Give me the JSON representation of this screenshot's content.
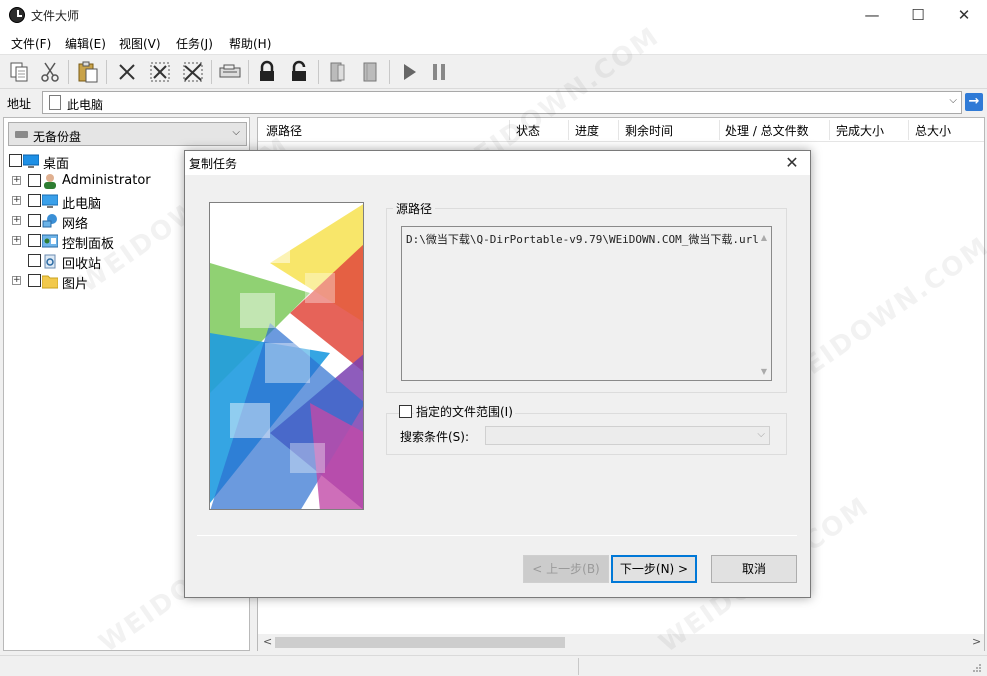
{
  "window": {
    "title": "文件大师",
    "controls": {
      "minimize": "—",
      "maximize": "☐",
      "close": "✕"
    }
  },
  "menu": [
    {
      "label": "文件(F)"
    },
    {
      "label": "编辑(E)"
    },
    {
      "label": "视图(V)"
    },
    {
      "label": "任务(J)"
    },
    {
      "label": "帮助(H)"
    }
  ],
  "toolbar": {
    "buttons": [
      "copy-icon",
      "cut-icon",
      "paste-icon",
      "delete-icon",
      "delete-selection-icon",
      "delete-all-icon",
      "device-icon",
      "lock-icon",
      "unlock-icon",
      "book-open-icon",
      "book-close-icon",
      "play-icon",
      "pause-icon"
    ]
  },
  "address": {
    "label": "地址",
    "value": "此电脑",
    "go": "→"
  },
  "left_panel": {
    "backup_combo": "无备份盘",
    "tree": [
      {
        "label": "桌面",
        "icon": "desktop-icon",
        "level": 0,
        "expandable": false
      },
      {
        "label": "Administrator",
        "icon": "user-icon",
        "level": 1,
        "expandable": true
      },
      {
        "label": "此电脑",
        "icon": "computer-icon",
        "level": 1,
        "expandable": true
      },
      {
        "label": "网络",
        "icon": "network-icon",
        "level": 1,
        "expandable": true
      },
      {
        "label": "控制面板",
        "icon": "control-panel-icon",
        "level": 1,
        "expandable": true
      },
      {
        "label": "回收站",
        "icon": "recycle-bin-icon",
        "level": 1,
        "expandable": false
      },
      {
        "label": "图片",
        "icon": "folder-icon",
        "level": 1,
        "expandable": true
      }
    ]
  },
  "task_table": {
    "columns": [
      "源路径",
      "状态",
      "进度",
      "剩余时间",
      "处理 / 总文件数",
      "完成大小",
      "总大小"
    ]
  },
  "scroll": {
    "left": "<",
    "right": ">"
  },
  "dialog": {
    "title": "复制任务",
    "close": "✕",
    "source_group_label": "源路径",
    "source_path": "D:\\微当下载\\Q-DirPortable-v9.79\\WEiDOWN.COM_微当下载.url",
    "range_checkbox_label": "指定的文件范围(I)",
    "search_label": "搜索条件(S):",
    "search_value": "",
    "buttons": {
      "prev": "< 上一步(B)",
      "next": "下一步(N) >",
      "cancel": "取消"
    }
  },
  "watermark": "WEIDOWN.COM"
}
